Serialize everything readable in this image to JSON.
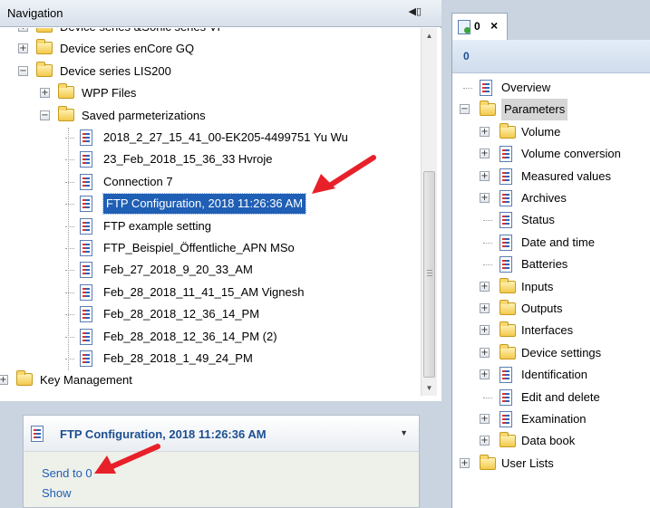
{
  "navigation": {
    "title": "Navigation",
    "tree": [
      {
        "label": "Device series &Sonic series VI",
        "kind": "folder",
        "expander": "+",
        "level": 1
      },
      {
        "label": "Device series enCore GQ",
        "kind": "folder",
        "expander": "+",
        "level": 1
      },
      {
        "label": "Device series LIS200",
        "kind": "folder",
        "expander": "−",
        "level": 1
      },
      {
        "label": "WPP Files",
        "kind": "folder",
        "expander": "+",
        "level": 2
      },
      {
        "label": "Saved parmeterizations",
        "kind": "folder",
        "expander": "−",
        "level": 2
      },
      {
        "label": "2018_2_27_15_41_00-EK205-4499751 Yu Wu",
        "kind": "doc",
        "level": 3
      },
      {
        "label": "23_Feb_2018_15_36_33 Hvroje",
        "kind": "doc",
        "level": 3
      },
      {
        "label": "Connection 7",
        "kind": "doc",
        "level": 3
      },
      {
        "label": "FTP Configuration, 2018 11:26:36 AM",
        "kind": "doc",
        "level": 3,
        "selected": true
      },
      {
        "label": "FTP example setting",
        "kind": "doc",
        "level": 3
      },
      {
        "label": "FTP_Beispiel_Öffentliche_APN MSo",
        "kind": "doc",
        "level": 3
      },
      {
        "label": "Feb_27_2018_9_20_33_AM",
        "kind": "doc",
        "level": 3
      },
      {
        "label": "Feb_28_2018_11_41_15_AM Vignesh",
        "kind": "doc",
        "level": 3
      },
      {
        "label": "Feb_28_2018_12_36_14_PM",
        "kind": "doc",
        "level": 3
      },
      {
        "label": "Feb_28_2018_12_36_14_PM (2)",
        "kind": "doc",
        "level": 3
      },
      {
        "label": "Feb_28_2018_1_49_24_PM",
        "kind": "doc",
        "level": 3
      },
      {
        "label": "Key Management",
        "kind": "folder",
        "expander": "+",
        "level": 0
      }
    ]
  },
  "task_panel": {
    "title": "FTP Configuration, 2018 11:26:36 AM",
    "links": [
      "Send to 0",
      "Show"
    ]
  },
  "right_panel": {
    "tab_label": "0",
    "tab_close": "×",
    "header_label": "0",
    "tree": [
      {
        "label": "Overview",
        "kind": "doc",
        "level": 0
      },
      {
        "label": "Parameters",
        "kind": "folder",
        "expander": "−",
        "level": 0,
        "selected": true
      },
      {
        "label": "Volume",
        "kind": "folder",
        "expander": "+",
        "level": 1
      },
      {
        "label": "Volume conversion",
        "kind": "doc",
        "expander": "+",
        "level": 1
      },
      {
        "label": "Measured values",
        "kind": "doc",
        "expander": "+",
        "level": 1
      },
      {
        "label": "Archives",
        "kind": "doc",
        "expander": "+",
        "level": 1
      },
      {
        "label": "Status",
        "kind": "doc",
        "level": 1
      },
      {
        "label": "Date and time",
        "kind": "doc",
        "level": 1
      },
      {
        "label": "Batteries",
        "kind": "doc",
        "level": 1
      },
      {
        "label": "Inputs",
        "kind": "folder",
        "expander": "+",
        "level": 1
      },
      {
        "label": "Outputs",
        "kind": "folder",
        "expander": "+",
        "level": 1
      },
      {
        "label": "Interfaces",
        "kind": "folder",
        "expander": "+",
        "level": 1
      },
      {
        "label": "Device settings",
        "kind": "folder",
        "expander": "+",
        "level": 1
      },
      {
        "label": "Identification",
        "kind": "doc",
        "expander": "+",
        "level": 1
      },
      {
        "label": "Edit and delete",
        "kind": "doc",
        "level": 1
      },
      {
        "label": "Examination",
        "kind": "doc",
        "expander": "+",
        "level": 1
      },
      {
        "label": "Data book",
        "kind": "folder",
        "expander": "+",
        "level": 1
      },
      {
        "label": "User Lists",
        "kind": "folder",
        "expander": "+",
        "level": 0
      }
    ]
  },
  "colors": {
    "selection": "#1f5fb5",
    "link": "#1f5fb5",
    "annotation_arrow": "#e8202a"
  }
}
